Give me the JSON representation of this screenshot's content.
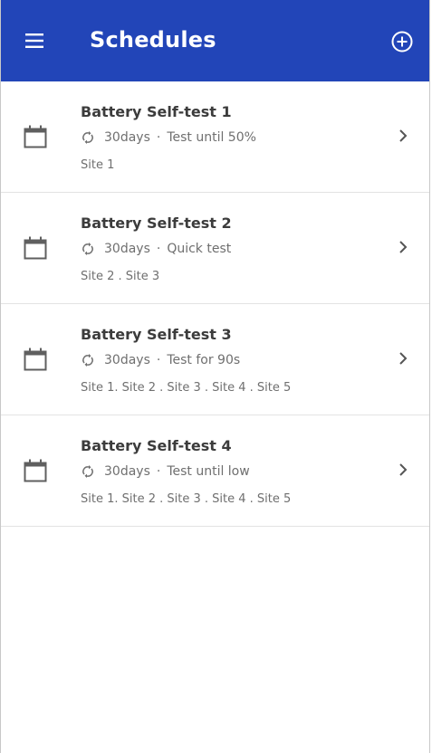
{
  "header": {
    "title": "Schedules",
    "bar_color": "#2245b8",
    "menu_icon": "hamburger-menu-icon",
    "add_icon": "add-circle-icon"
  },
  "schedules": [
    {
      "title": "Battery Self-test 1",
      "interval": "30days",
      "separator": "·",
      "test": "Test until 50%",
      "sites": "Site 1"
    },
    {
      "title": "Battery Self-test 2",
      "interval": "30days",
      "separator": "·",
      "test": "Quick test",
      "sites": "Site 2 . Site 3"
    },
    {
      "title": "Battery Self-test 3",
      "interval": "30days",
      "separator": "·",
      "test": "Test for 90s",
      "sites": "Site 1. Site 2 . Site 3 . Site 4 . Site 5"
    },
    {
      "title": "Battery Self-test 4",
      "interval": "30days",
      "separator": "·",
      "test": "Test until low",
      "sites": "Site 1. Site 2 . Site 3 . Site 4 . Site 5"
    }
  ],
  "icons": {
    "item_icon": "calendar-icon",
    "repeat_icon": "repeat-icon",
    "chevron_icon": "chevron-right-icon"
  }
}
